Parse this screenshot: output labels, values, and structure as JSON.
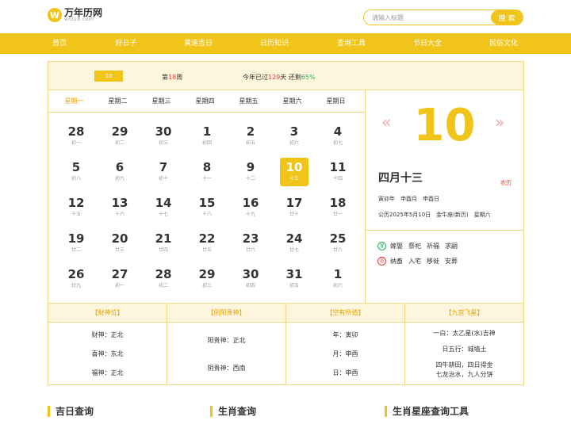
{
  "logo": {
    "badge": "W",
    "title": "万年历网",
    "sub": "wnl18.com"
  },
  "search": {
    "placeholder": "请输入标题",
    "button": "搜 索"
  },
  "nav": [
    "首页",
    "好日子",
    "黄道吉日",
    "日历知识",
    "查询工具",
    "节日大全",
    "民俗文化"
  ],
  "topbar": {
    "week_select": "10",
    "week_prefix": "第",
    "week_num": "18",
    "week_suffix": "周",
    "progress_prefix": "今年已过",
    "days_passed": "129",
    "progress_mid": "天 还剩",
    "percent_left": "65%"
  },
  "weekdays": [
    "星期一",
    "星期二",
    "星期三",
    "星期四",
    "星期五",
    "星期六",
    "星期日"
  ],
  "days": [
    [
      [
        "28",
        "初一"
      ],
      [
        "29",
        "初二"
      ],
      [
        "30",
        "初三"
      ],
      [
        "1",
        "初四"
      ],
      [
        "2",
        "初五"
      ],
      [
        "3",
        "初六"
      ],
      [
        "4",
        "初七"
      ]
    ],
    [
      [
        "5",
        "初八"
      ],
      [
        "6",
        "初九"
      ],
      [
        "7",
        "初十"
      ],
      [
        "8",
        "十一"
      ],
      [
        "9",
        "十二"
      ],
      [
        "10",
        "十三"
      ],
      [
        "11",
        "十四"
      ]
    ],
    [
      [
        "12",
        "十五"
      ],
      [
        "13",
        "十六"
      ],
      [
        "14",
        "十七"
      ],
      [
        "15",
        "十八"
      ],
      [
        "16",
        "十九"
      ],
      [
        "17",
        "廿十"
      ],
      [
        "18",
        "廿一"
      ]
    ],
    [
      [
        "19",
        "廿二"
      ],
      [
        "20",
        "廿三"
      ],
      [
        "21",
        "廿四"
      ],
      [
        "22",
        "廿五"
      ],
      [
        "23",
        "廿六"
      ],
      [
        "24",
        "廿七"
      ],
      [
        "25",
        "廿八"
      ]
    ],
    [
      [
        "26",
        "廿九"
      ],
      [
        "27",
        "初一"
      ],
      [
        "28",
        "初二"
      ],
      [
        "29",
        "初三"
      ],
      [
        "30",
        "初四"
      ],
      [
        "31",
        "初五"
      ],
      [
        "1",
        "初六"
      ]
    ]
  ],
  "selected": {
    "row": 1,
    "col": 5
  },
  "detail": {
    "big_day": "10",
    "lunar": "四月十三",
    "lunar_tag": "农历",
    "ganzhi": "寅卯年　申酉月　申酉日",
    "solar": "公历2025年5月10日　金牛座(新历)　星期六"
  },
  "yi": {
    "badge": "宜",
    "items": [
      "嫁娶",
      "祭祀",
      "祈福",
      "求嗣"
    ]
  },
  "ji": {
    "badge": "忌",
    "items": [
      "纳畜",
      "入宅",
      "移徙",
      "安葬"
    ]
  },
  "info": [
    {
      "head": "【财神位】",
      "lines": [
        "财神：正北",
        "喜神：东北",
        "福神：正北"
      ]
    },
    {
      "head": "【阴阳贵神】",
      "lines": [
        "阳贵神：正北",
        "阴贵神：西南"
      ]
    },
    {
      "head": "【空有所值】",
      "lines": [
        "年：寅卯",
        "月：申酉",
        "日：申酉"
      ]
    },
    {
      "head": "【九宫飞星】",
      "lines": [
        "一白：太乙星(水)吉神",
        "日五行：城墙土",
        "四牛耕田，四日得金",
        "七龙治水，九人分饼"
      ]
    }
  ],
  "sections": [
    "吉日查询",
    "生肖查询",
    "生肖星座查询工具"
  ],
  "colors": {
    "accent": "#f0c419",
    "border": "#f2d982",
    "red": "#e53935",
    "green": "#2eae5d"
  }
}
